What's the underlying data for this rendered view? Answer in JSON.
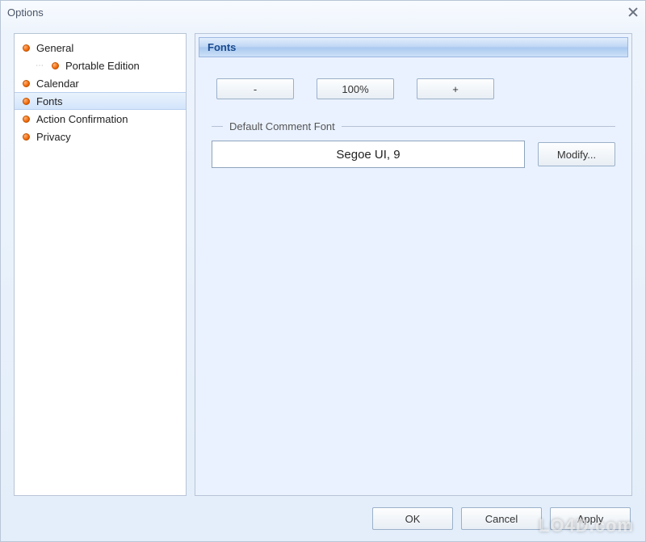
{
  "window": {
    "title": "Options"
  },
  "sidebar": {
    "items": [
      {
        "label": "General",
        "child": false,
        "selected": false
      },
      {
        "label": "Portable Edition",
        "child": true,
        "selected": false
      },
      {
        "label": "Calendar",
        "child": false,
        "selected": false
      },
      {
        "label": "Fonts",
        "child": false,
        "selected": true
      },
      {
        "label": "Action Confirmation",
        "child": false,
        "selected": false
      },
      {
        "label": "Privacy",
        "child": false,
        "selected": false
      }
    ]
  },
  "panel": {
    "header": "Fonts",
    "zoom": {
      "minus": "-",
      "value": "100%",
      "plus": "+"
    },
    "fieldset": {
      "legend": "Default Comment Font",
      "value": "Segoe UI, 9",
      "modify": "Modify..."
    }
  },
  "footer": {
    "ok": "OK",
    "cancel": "Cancel",
    "apply": "Apply"
  },
  "watermark": "LO4D.com"
}
